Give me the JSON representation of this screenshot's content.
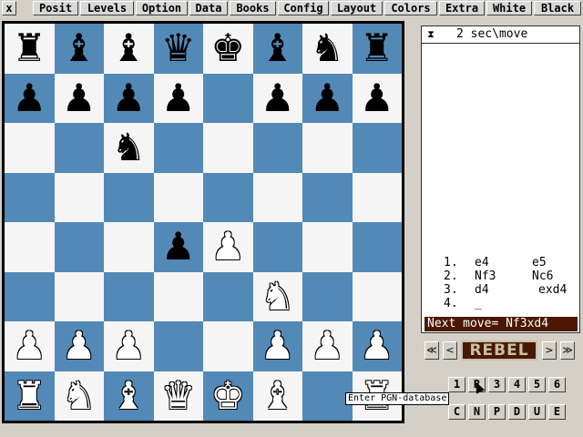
{
  "menu": {
    "close_label": "x",
    "items": [
      "Posit",
      "Levels",
      "Option",
      "Data",
      "Books",
      "Config",
      "Layout",
      "Colors",
      "Extra",
      "White",
      "Black"
    ]
  },
  "board": {
    "light_color": "#f5f5f5",
    "dark_color": "#5389b7",
    "ranks": [
      [
        "br",
        "bb_",
        "bb",
        "bq",
        "bk",
        "bb",
        "bn",
        "br"
      ],
      [
        "bp",
        "bp",
        "bp",
        "bp",
        "",
        "bp",
        "bp",
        "bp"
      ],
      [
        "",
        "",
        "bn",
        "",
        "",
        "",
        "",
        ""
      ],
      [
        "",
        "",
        "",
        "",
        "",
        "",
        "",
        ""
      ],
      [
        "",
        "",
        "",
        "bp",
        "wp",
        "",
        "",
        ""
      ],
      [
        "",
        "",
        "",
        "",
        "",
        "wn",
        "",
        ""
      ],
      [
        "wp",
        "wp",
        "wp",
        "",
        "",
        "wp",
        "wp",
        "wp"
      ],
      [
        "wr",
        "wn",
        "wb",
        "wq",
        "wk",
        "wb",
        "",
        "wr"
      ]
    ]
  },
  "panel": {
    "clock_icon": "⧗",
    "time_control": "2 sec\\move",
    "moves": [
      {
        "num": "1.",
        "white": "e4",
        "black": "e5"
      },
      {
        "num": "2.",
        "white": "Nf3",
        "black": "Nc6"
      },
      {
        "num": "3.",
        "white": "d4",
        "black": "exd4"
      },
      {
        "num": "4.",
        "white": "_",
        "black": ""
      }
    ],
    "next_move": "Next move= Nf3xd4"
  },
  "nav": {
    "first": "≪",
    "prev": "<",
    "logo": "REBEL",
    "next": ">",
    "last": "≫"
  },
  "buttons": {
    "row1": [
      "1",
      "R",
      "3",
      "4",
      "5",
      "6"
    ],
    "row2": [
      "C",
      "N",
      "P",
      "D",
      "U",
      "E"
    ]
  },
  "tooltip": "Enter PGN-database"
}
